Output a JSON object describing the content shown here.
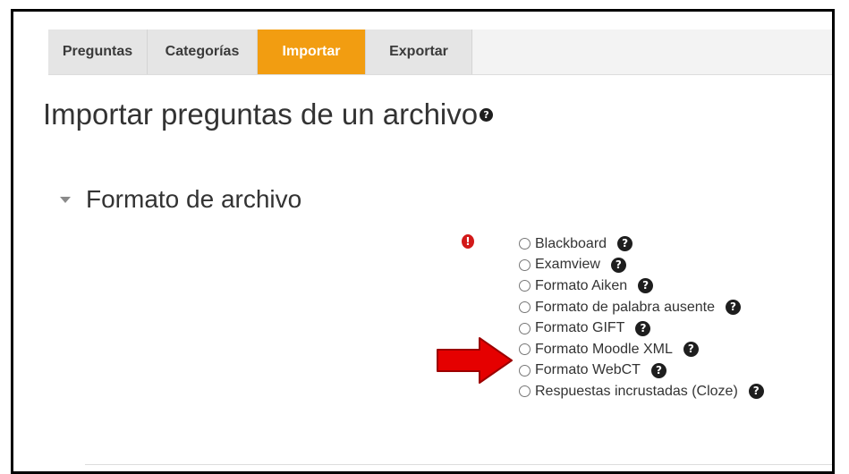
{
  "tabs": [
    {
      "label": "Preguntas",
      "active": false
    },
    {
      "label": "Categorías",
      "active": false
    },
    {
      "label": "Importar",
      "active": true
    },
    {
      "label": "Exportar",
      "active": false
    }
  ],
  "page": {
    "title": "Importar preguntas de un archivo",
    "help_icon": "question-circle-icon"
  },
  "section": {
    "title": "Formato de archivo",
    "collapse_icon": "caret-down-icon",
    "required_icon": "exclamation-circle-icon",
    "required_glyph": "!"
  },
  "formats": [
    {
      "label": "Blackboard",
      "selected": false
    },
    {
      "label": "Examview",
      "selected": false
    },
    {
      "label": "Formato Aiken",
      "selected": false
    },
    {
      "label": "Formato de palabra ausente",
      "selected": false
    },
    {
      "label": "Formato GIFT",
      "selected": false,
      "highlighted": true
    },
    {
      "label": "Formato Moodle XML",
      "selected": false
    },
    {
      "label": "Formato WebCT",
      "selected": false
    },
    {
      "label": "Respuestas incrustadas (Cloze)",
      "selected": false
    }
  ],
  "help_glyph": "?",
  "annotation": {
    "icon": "arrow-right-icon",
    "color": "#e50000",
    "points_to": "Formato GIFT"
  },
  "colors": {
    "active_tab": "#f29d11",
    "required": "#d21919"
  }
}
